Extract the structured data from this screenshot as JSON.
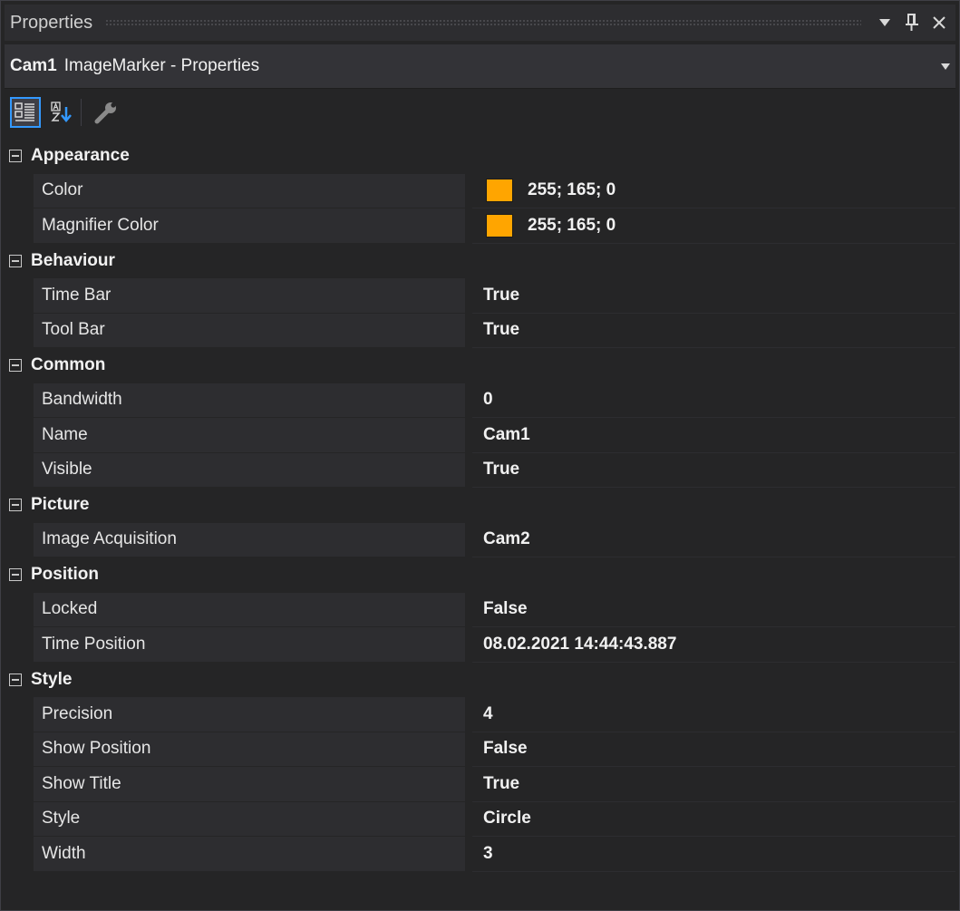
{
  "window": {
    "title": "Properties",
    "dropdown_icon": "dropdown-arrow-icon",
    "pin_icon": "pin-icon",
    "close_icon": "close-icon"
  },
  "selector": {
    "object_name": "Cam1",
    "object_type": "ImageMarker - Properties"
  },
  "toolbar": {
    "buttons": [
      {
        "icon": "categorized-icon",
        "active": true
      },
      {
        "icon": "alphabetical-sort-icon",
        "active": false
      },
      {
        "icon": "property-pages-wrench-icon",
        "active": false
      }
    ]
  },
  "colors": {
    "swatch": "#ffa500",
    "accent": "#3399ff"
  },
  "categories": [
    {
      "label": "Appearance",
      "rows": [
        {
          "name": "Color",
          "value": "255; 165; 0",
          "swatch": true
        },
        {
          "name": "Magnifier Color",
          "value": "255; 165; 0",
          "swatch": true
        }
      ]
    },
    {
      "label": "Behaviour",
      "rows": [
        {
          "name": "Time Bar",
          "value": "True"
        },
        {
          "name": "Tool Bar",
          "value": "True"
        }
      ]
    },
    {
      "label": "Common",
      "rows": [
        {
          "name": "Bandwidth",
          "value": "0"
        },
        {
          "name": "Name",
          "value": "Cam1"
        },
        {
          "name": "Visible",
          "value": "True"
        }
      ]
    },
    {
      "label": "Picture",
      "rows": [
        {
          "name": "Image Acquisition",
          "value": "Cam2"
        }
      ]
    },
    {
      "label": "Position",
      "rows": [
        {
          "name": "Locked",
          "value": "False"
        },
        {
          "name": "Time Position",
          "value": "08.02.2021 14:44:43.887"
        }
      ]
    },
    {
      "label": "Style",
      "rows": [
        {
          "name": "Precision",
          "value": "4"
        },
        {
          "name": "Show Position",
          "value": "False"
        },
        {
          "name": "Show Title",
          "value": "True"
        },
        {
          "name": "Style",
          "value": "Circle"
        },
        {
          "name": "Width",
          "value": "3"
        }
      ]
    }
  ]
}
